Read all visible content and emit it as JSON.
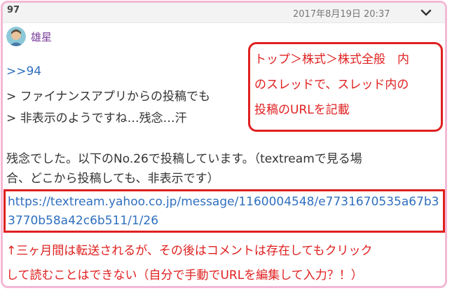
{
  "post": {
    "number": "97",
    "date": "2017年8月19日 20:37",
    "username": "雄星",
    "reply_ref": ">>94",
    "quote_lines": [
      "> ファイナンスアプリからの投稿でも",
      "> 非表示のようですね…残念…汗"
    ],
    "body_lines": [
      "残念でした。以下のNo.26で投稿しています。（textreamで見る場",
      "合、どこから投稿しても、非表示です）"
    ],
    "url": "https://textream.yahoo.co.jp/message/1160004548/e7731670535a67b33770b58a42c6b511/1/26"
  },
  "annotations": {
    "callout_lines": [
      "トップ＞株式＞株式全般　内",
      "のスレッドで、スレッド内の",
      "投稿のURLを記載"
    ],
    "note_lines": [
      "↑三ヶ月間は転送されるが、その後はコメントは存在してもクリック",
      "して読むことはできない（自分で手動でURLを編集して入力？！）"
    ]
  },
  "colors": {
    "frame": "#f4b8d6",
    "annotation_red": "#e02020",
    "link_blue": "#2f6fbf",
    "username_purple": "#7a3e99"
  },
  "icons": {
    "menu": "chevron-down-icon",
    "avatar": "user-avatar-icon"
  }
}
